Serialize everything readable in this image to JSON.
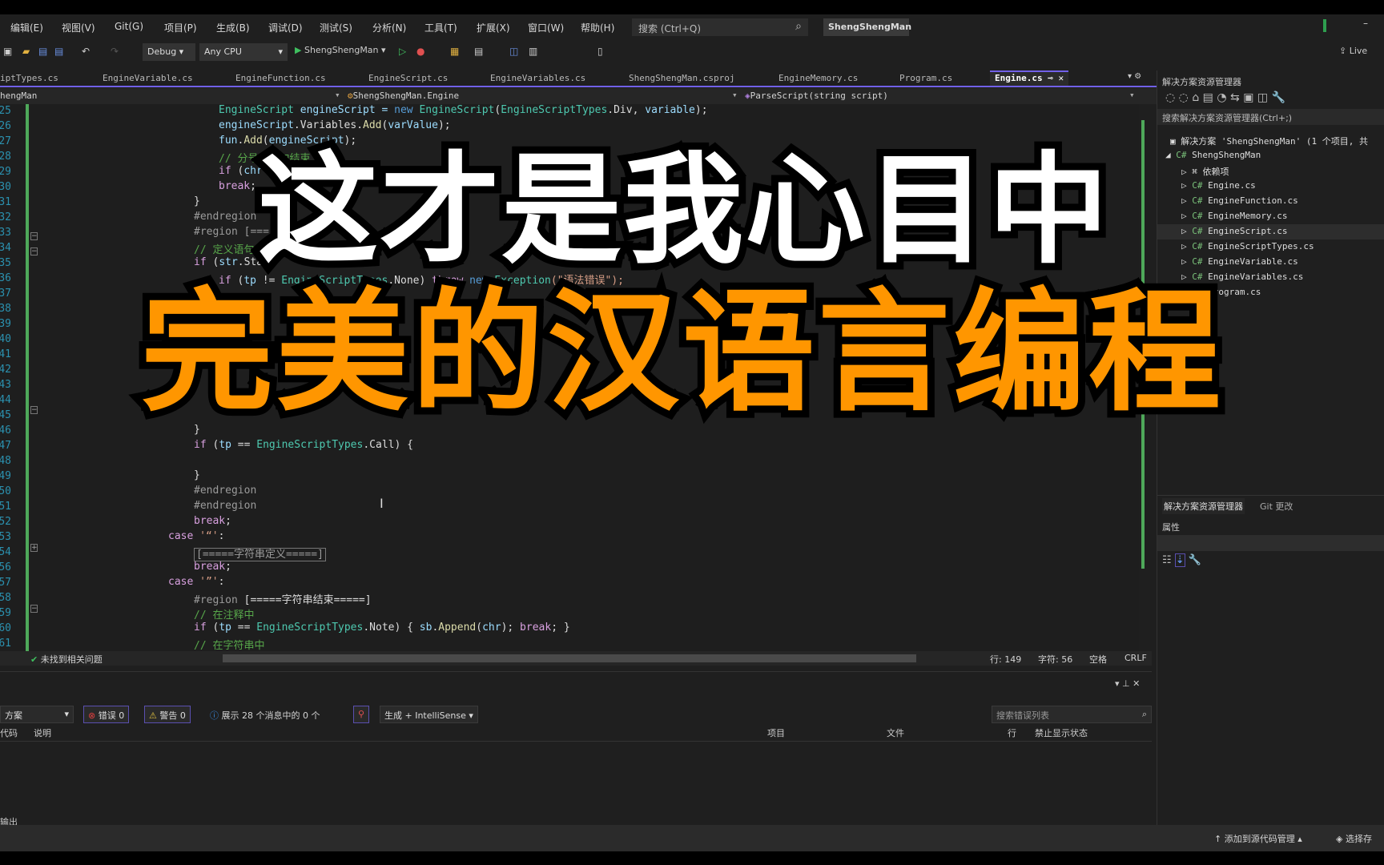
{
  "menu": [
    "编辑(E)",
    "视图(V)",
    "Git(G)",
    "项目(P)",
    "生成(B)",
    "调试(D)",
    "测试(S)",
    "分析(N)",
    "工具(T)",
    "扩展(X)",
    "窗口(W)",
    "帮助(H)"
  ],
  "search_placeholder": "搜索 (Ctrl+Q)",
  "solution_name": "ShengShengMan",
  "toolbar": {
    "config": "Debug",
    "platform": "Any CPU",
    "run_target": "ShengShengMan",
    "live": "Live"
  },
  "tabs": [
    "iptTypes.cs",
    "EngineVariable.cs",
    "EngineFunction.cs",
    "EngineScript.cs",
    "EngineVariables.cs",
    "ShengShengMan.csproj",
    "EngineMemory.cs",
    "Program.cs",
    "Engine.cs"
  ],
  "nav": {
    "project": "hengMan",
    "class": "ShengShengMan.Engine",
    "member": "ParseScript(string script)"
  },
  "code": [
    {
      "n": "25",
      "i": 3,
      "t": [
        [
          "EngineScript",
          "type"
        ],
        [
          " engineScript = ",
          "var"
        ],
        [
          "new ",
          "kw"
        ],
        [
          "EngineScript",
          "type"
        ],
        [
          "(",
          "plain"
        ],
        [
          "EngineScriptTypes",
          "type"
        ],
        [
          ".Div, ",
          "plain"
        ],
        [
          "variable",
          "var"
        ],
        [
          ");",
          "plain"
        ]
      ]
    },
    {
      "n": "26",
      "i": 3,
      "t": [
        [
          "engineScript",
          "var"
        ],
        [
          ".Variables.",
          "plain"
        ],
        [
          "Add",
          "fn"
        ],
        [
          "(",
          "plain"
        ],
        [
          "varValue",
          "var"
        ],
        [
          ");",
          "plain"
        ]
      ]
    },
    {
      "n": "27",
      "i": 3,
      "t": [
        [
          "fun",
          "var"
        ],
        [
          ".",
          "plain"
        ],
        [
          "Add",
          "fn"
        ],
        [
          "(",
          "plain"
        ],
        [
          "engineScript",
          "var"
        ],
        [
          ");",
          "plain"
        ]
      ]
    },
    {
      "n": "28",
      "i": 3,
      "t": [
        [
          "// 分号为语句结束",
          "cm"
        ]
      ]
    },
    {
      "n": "29",
      "i": 3,
      "t": [
        [
          "if ",
          "ctl"
        ],
        [
          "(",
          "plain"
        ],
        [
          "chr",
          "var"
        ]
      ]
    },
    {
      "n": "30",
      "i": 3,
      "t": [
        [
          "break",
          "ctl"
        ],
        [
          ";",
          "plain"
        ]
      ]
    },
    {
      "n": "31",
      "i": 2,
      "t": [
        [
          "}",
          "plain"
        ]
      ]
    },
    {
      "n": "32",
      "i": 2,
      "t": [
        [
          "#endregion",
          "pp"
        ]
      ]
    },
    {
      "n": "33",
      "i": 2,
      "t": [
        [
          "#region [===",
          "pp"
        ]
      ]
    },
    {
      "n": "34",
      "i": 2,
      "t": [
        [
          "// 定义语句的",
          "cm"
        ]
      ]
    },
    {
      "n": "35",
      "i": 2,
      "t": [
        [
          "if ",
          "ctl"
        ],
        [
          "(",
          "plain"
        ],
        [
          "str",
          "var"
        ],
        [
          ".Star",
          "plain"
        ]
      ]
    },
    {
      "n": "36",
      "i": 3,
      "t": [
        [
          "if ",
          "ctl"
        ],
        [
          "(",
          "plain"
        ],
        [
          "tp",
          "var"
        ],
        [
          " != ",
          "plain"
        ],
        [
          "EngineScriptTypes",
          "type"
        ],
        [
          ".None) ",
          "plain"
        ],
        [
          "throw ",
          "ctl"
        ],
        [
          "new ",
          "kw"
        ],
        [
          "Exception",
          "type"
        ],
        [
          "(\"语法错误\");",
          "str"
        ]
      ]
    },
    {
      "n": "37",
      "i": 3,
      "t": []
    },
    {
      "n": "38",
      "i": 3,
      "t": []
    },
    {
      "n": "39",
      "i": 3,
      "t": []
    },
    {
      "n": "40",
      "i": 3,
      "t": []
    },
    {
      "n": "41",
      "i": 3,
      "t": []
    },
    {
      "n": "42",
      "i": 3,
      "t": []
    },
    {
      "n": "43",
      "i": 3,
      "t": []
    },
    {
      "n": "44",
      "i": 3,
      "t": []
    },
    {
      "n": "45",
      "i": 3,
      "t": []
    },
    {
      "n": "46",
      "i": 2,
      "t": [
        [
          "}",
          "plain"
        ]
      ]
    },
    {
      "n": "47",
      "i": 2,
      "t": [
        [
          "if ",
          "ctl"
        ],
        [
          "(",
          "plain"
        ],
        [
          "tp",
          "var"
        ],
        [
          " == ",
          "plain"
        ],
        [
          "EngineScriptTypes",
          "type"
        ],
        [
          ".Call) {",
          "plain"
        ]
      ]
    },
    {
      "n": "48",
      "i": 2,
      "t": []
    },
    {
      "n": "49",
      "i": 2,
      "t": [
        [
          "}",
          "plain"
        ]
      ]
    },
    {
      "n": "50",
      "i": 2,
      "t": [
        [
          "#endregion",
          "pp"
        ]
      ]
    },
    {
      "n": "51",
      "i": 2,
      "t": [
        [
          "#endregion",
          "pp"
        ]
      ]
    },
    {
      "n": "52",
      "i": 2,
      "t": [
        [
          "break",
          "ctl"
        ],
        [
          ";",
          "plain"
        ]
      ]
    },
    {
      "n": "53",
      "i": 1,
      "t": [
        [
          "case ",
          "ctl"
        ],
        [
          "'“'",
          "str"
        ],
        [
          ":",
          "plain"
        ]
      ]
    },
    {
      "n": "54",
      "i": 2,
      "t": [
        [
          "[=====字符串定义=====]",
          "box"
        ]
      ]
    },
    {
      "n": "56",
      "i": 2,
      "t": [
        [
          "break",
          "ctl"
        ],
        [
          ";",
          "plain"
        ]
      ]
    },
    {
      "n": "57",
      "i": 1,
      "t": [
        [
          "case ",
          "ctl"
        ],
        [
          "'”'",
          "str"
        ],
        [
          ":",
          "plain"
        ]
      ]
    },
    {
      "n": "58",
      "i": 2,
      "t": [
        [
          "#region ",
          "pp"
        ],
        [
          "[=====字符串结束=====]",
          "plain"
        ]
      ]
    },
    {
      "n": "59",
      "i": 2,
      "t": [
        [
          "// 在注释中",
          "cm"
        ]
      ]
    },
    {
      "n": "60",
      "i": 2,
      "t": [
        [
          "if ",
          "ctl"
        ],
        [
          "(",
          "plain"
        ],
        [
          "tp",
          "var"
        ],
        [
          " == ",
          "plain"
        ],
        [
          "EngineScriptTypes",
          "type"
        ],
        [
          ".Note) { ",
          "plain"
        ],
        [
          "sb",
          "var"
        ],
        [
          ".",
          "plain"
        ],
        [
          "Append",
          "fn"
        ],
        [
          "(",
          "plain"
        ],
        [
          "chr",
          "var"
        ],
        [
          "); ",
          "plain"
        ],
        [
          "break",
          "ctl"
        ],
        [
          "; }",
          "plain"
        ]
      ]
    },
    {
      "n": "61",
      "i": 2,
      "t": [
        [
          "// 在字符串中",
          "cm"
        ]
      ]
    }
  ],
  "status": {
    "issues": "未找到相关问题",
    "line": "行: 149",
    "char": "字符: 56",
    "spaces": "空格",
    "eol": "CRLF"
  },
  "errors": {
    "scope": "方案",
    "errors": "错误 0",
    "warnings": "警告 0",
    "messages": "展示 28 个消息中的 0 个",
    "source": "生成 + IntelliSense",
    "search": "搜索错误列表",
    "cols": [
      "代码",
      "说明",
      "项目",
      "文件",
      "行",
      "禁止显示状态"
    ],
    "output_tab": "输出"
  },
  "explorer": {
    "title": "解决方案资源管理器",
    "search": "搜索解决方案资源管理器(Ctrl+;)",
    "solution": "解决方案 'ShengShengMan' (1 个项目, 共",
    "project": "ShengShengMan",
    "deps": "依赖项",
    "files": [
      "Engine.cs",
      "EngineFunction.cs",
      "EngineMemory.cs",
      "EngineScript.cs",
      "EngineScriptTypes.cs",
      "EngineVariable.cs",
      "EngineVariables.cs",
      "Program.cs"
    ],
    "tab1": "解决方案资源管理器",
    "tab2": "Git 更改",
    "props": "属性"
  },
  "bottom": {
    "source_control": "添加到源代码管理",
    "repo": "选择存"
  },
  "overlay": {
    "line1": "这才是我心目中",
    "line2": "完美的汉语言编程"
  },
  "colors": {
    "accent": "#7160e8",
    "overlay_orange": "#ff9600"
  }
}
